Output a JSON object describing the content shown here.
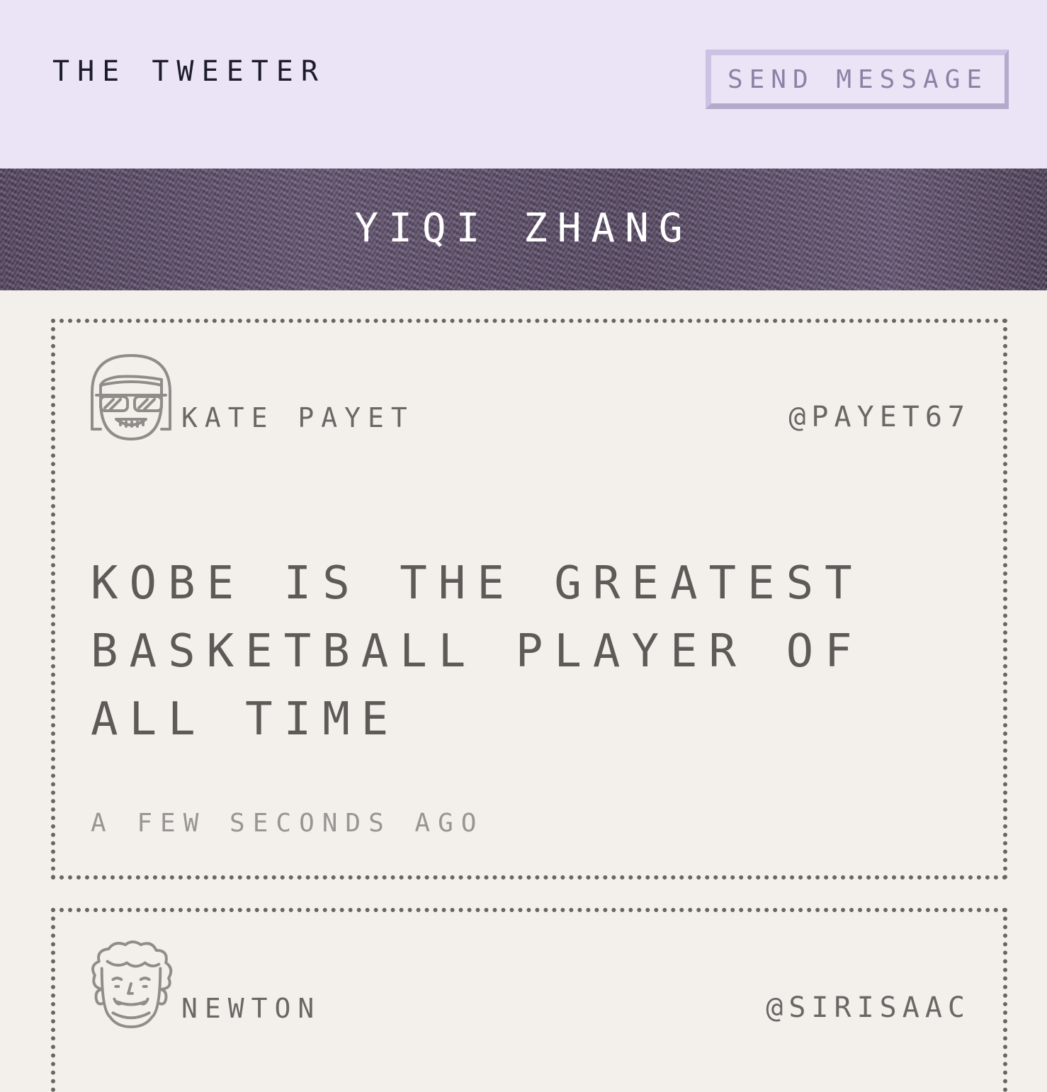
{
  "header": {
    "brand": "THE TWEETER",
    "send_button_label": "SEND MESSAGE"
  },
  "banner": {
    "user_name": "YIQI ZHANG"
  },
  "tweets": [
    {
      "author_name": "KATE PAYET",
      "handle": "@PAYET67",
      "avatar_icon": "girl-with-sunglasses-avatar-icon",
      "text": "KOBE IS THE GREATEST BASKETBALL PLAYER OF ALL TIME",
      "timestamp": "A FEW SECONDS AGO"
    },
    {
      "author_name": "NEWTON",
      "handle": "@SIRISAAC",
      "avatar_icon": "curly-hair-man-avatar-icon"
    }
  ]
}
